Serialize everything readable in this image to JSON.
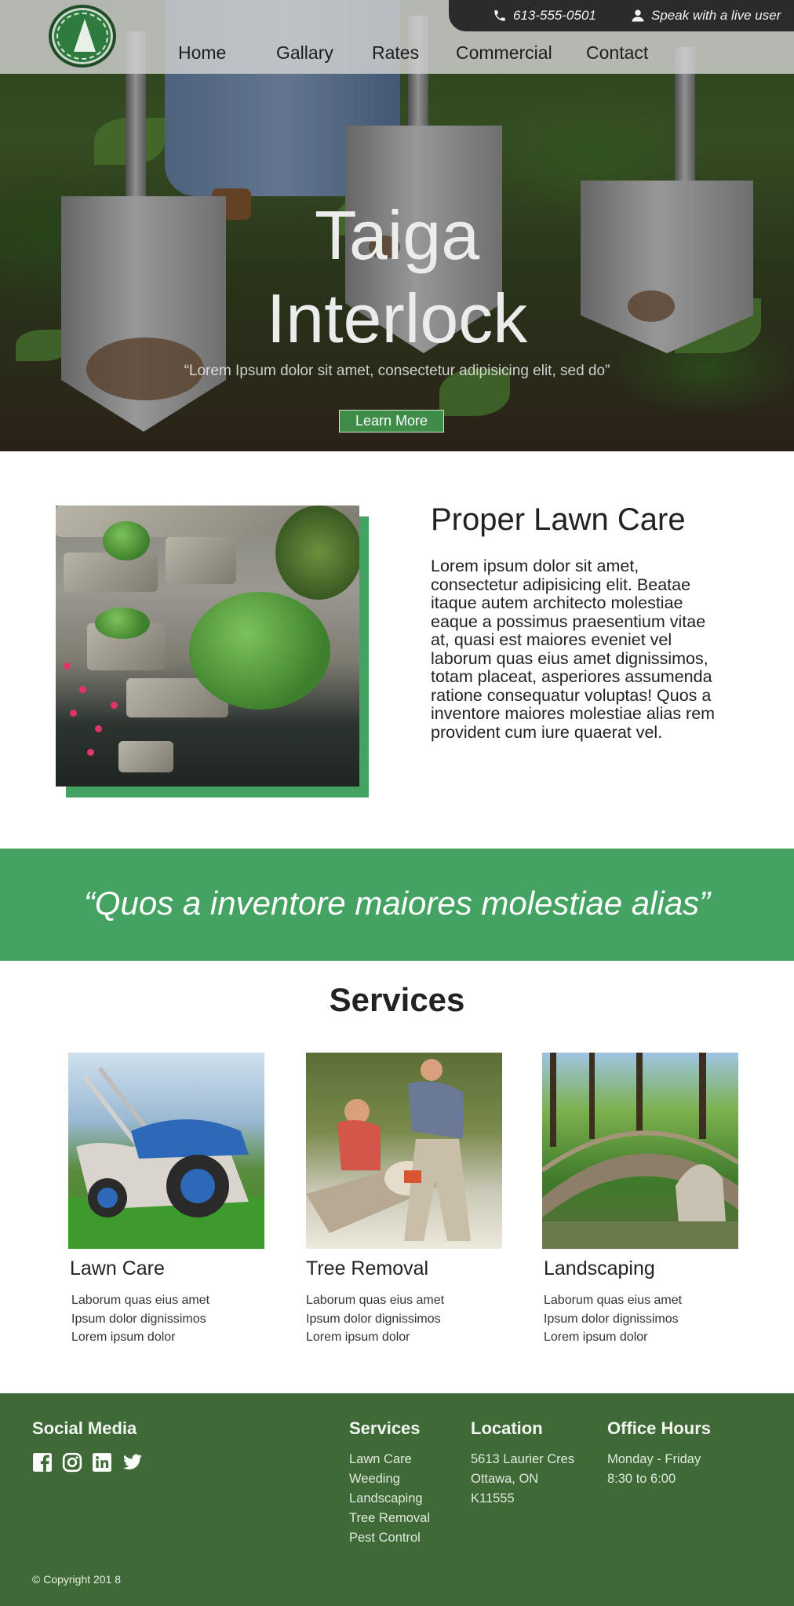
{
  "header": {
    "phone": "613-555-0501",
    "live_user": "Speak with a live user",
    "nav": [
      "Home",
      "Gallary",
      "Rates",
      "Commercial",
      "Contact"
    ]
  },
  "hero": {
    "title_line1": "Taiga",
    "title_line2": "Interlock",
    "subtitle": "“Lorem Ipsum dolor sit amet, consectetur adipisicing elit, sed do”",
    "cta": "Learn More"
  },
  "about": {
    "title": "Proper Lawn Care",
    "body": "Lorem ipsum dolor sit amet, consectetur adipisicing elit. Beatae itaque autem architecto molestiae eaque a possimus praesentium vitae at, quasi est maiores eveniet vel laborum quas eius amet dignissimos, totam placeat, asperiores assumenda ratione consequatur voluptas! Quos a inventore maiores molestiae alias rem provident cum iure quaerat vel."
  },
  "banner": {
    "quote": "“Quos a inventore maiores molestiae alias”"
  },
  "services": {
    "title": "Services",
    "items": [
      {
        "name": "Lawn Care",
        "lines": [
          "Laborum quas eius amet",
          "Ipsum dolor dignissimos",
          "Lorem ipsum dolor"
        ]
      },
      {
        "name": "Tree Removal",
        "lines": [
          "Laborum quas eius amet",
          "Ipsum dolor dignissimos",
          "Lorem ipsum dolor"
        ]
      },
      {
        "name": "Landscaping",
        "lines": [
          "Laborum quas eius amet",
          "Ipsum dolor dignissimos",
          "Lorem ipsum dolor"
        ]
      }
    ]
  },
  "footer": {
    "social_title": "Social Media",
    "social_icons": [
      "facebook-icon",
      "instagram-icon",
      "linkedin-icon",
      "twitter-icon"
    ],
    "services_title": "Services",
    "services": [
      "Lawn Care",
      "Weeding",
      "Landscaping",
      "Tree Removal",
      "Pest Control"
    ],
    "location_title": "Location",
    "location": [
      "5613 Laurier Cres",
      "Ottawa, ON",
      "K11555"
    ],
    "hours_title": "Office Hours",
    "hours": [
      "Monday - Friday",
      "8:30 to 6:00"
    ],
    "copyright": "© Copyright 201 8"
  },
  "colors": {
    "accent_green": "#44a262",
    "footer_green": "#3f6a38",
    "topbar_dark": "#2b2b2b"
  }
}
